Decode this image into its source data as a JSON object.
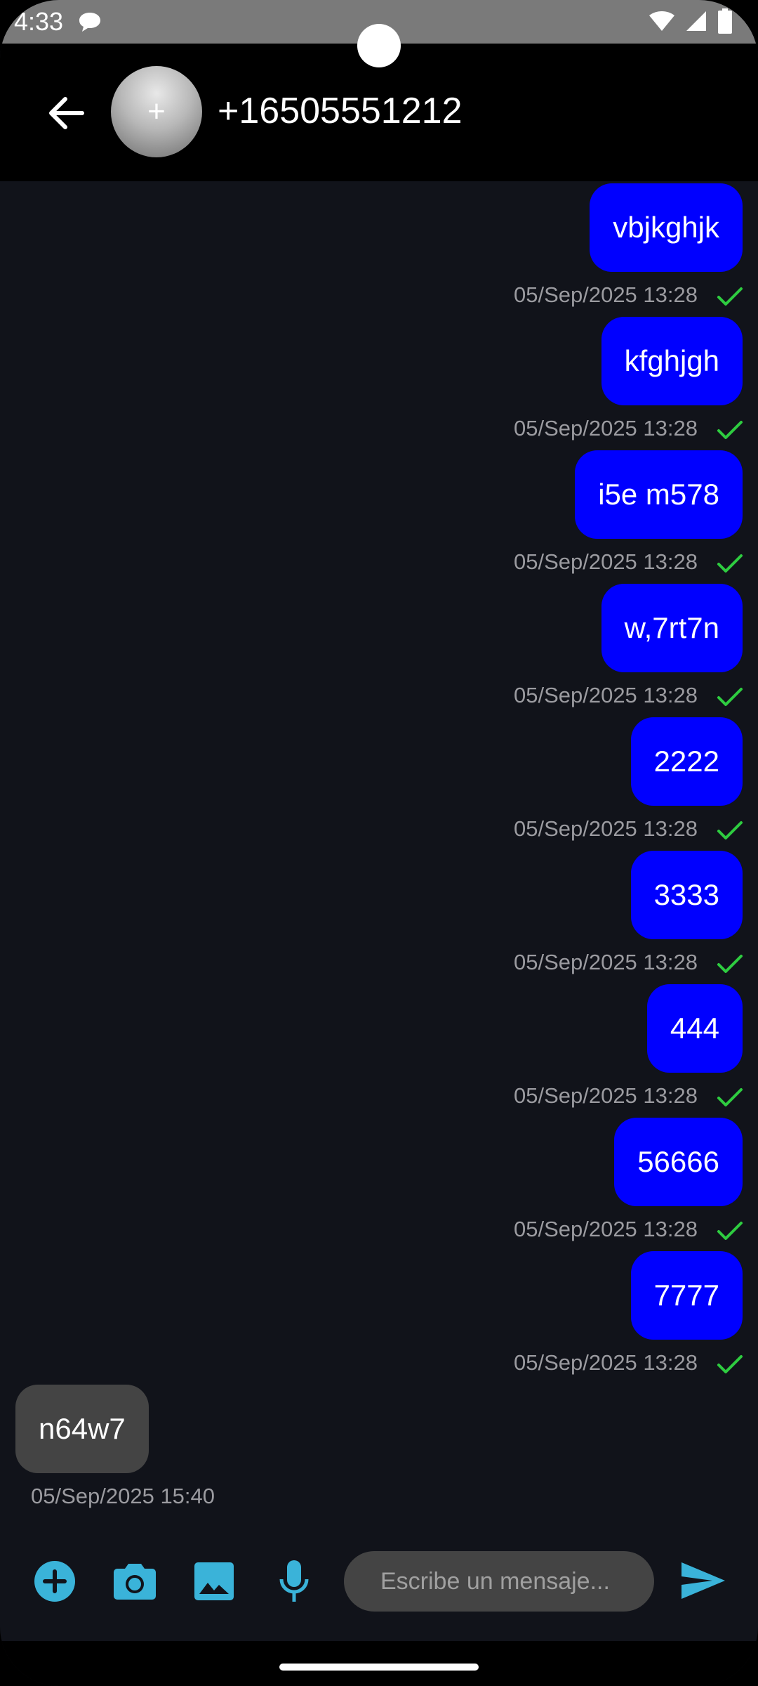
{
  "status_bar": {
    "time": "4:33"
  },
  "header": {
    "back_icon": "arrow-left-icon",
    "avatar_symbol": "+",
    "contact": "+16505551212"
  },
  "messages": [
    {
      "direction": "out",
      "text": "vbjkghjk",
      "timestamp": "05/Sep/2025 13:28",
      "status": "delivered"
    },
    {
      "direction": "out",
      "text": "kfghjgh",
      "timestamp": "05/Sep/2025 13:28",
      "status": "delivered"
    },
    {
      "direction": "out",
      "text": "i5e m578",
      "timestamp": "05/Sep/2025 13:28",
      "status": "delivered"
    },
    {
      "direction": "out",
      "text": "w,7rt7n",
      "timestamp": "05/Sep/2025 13:28",
      "status": "delivered"
    },
    {
      "direction": "out",
      "text": "2222",
      "timestamp": "05/Sep/2025 13:28",
      "status": "delivered"
    },
    {
      "direction": "out",
      "text": "3333",
      "timestamp": "05/Sep/2025 13:28",
      "status": "delivered"
    },
    {
      "direction": "out",
      "text": "444",
      "timestamp": "05/Sep/2025 13:28",
      "status": "delivered"
    },
    {
      "direction": "out",
      "text": "56666",
      "timestamp": "05/Sep/2025 13:28",
      "status": "delivered"
    },
    {
      "direction": "out",
      "text": "7777",
      "timestamp": "05/Sep/2025 13:28",
      "status": "delivered"
    },
    {
      "direction": "in",
      "text": "n64w7",
      "timestamp": "05/Sep/2025 15:40"
    }
  ],
  "composer": {
    "placeholder": "Escribe un mensaje...",
    "value": "",
    "tools": [
      "add-circle-icon",
      "camera-icon",
      "image-icon",
      "mic-icon"
    ],
    "send_icon": "send-icon"
  },
  "colors": {
    "outgoing_bubble": "#0000ff",
    "incoming_bubble": "#444444",
    "background": "#11131a",
    "accent": "#3ab3d9",
    "check": "#2ecc40"
  }
}
